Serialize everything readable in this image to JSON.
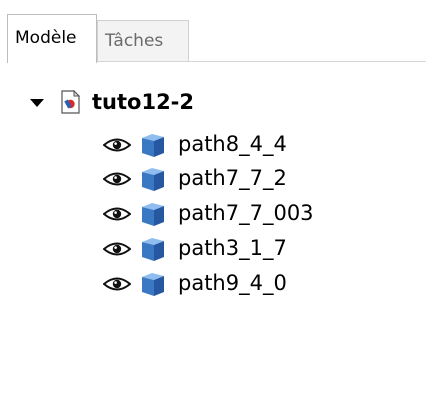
{
  "tabs": [
    {
      "label": "Modèle",
      "active": true
    },
    {
      "label": "Tâches",
      "active": false
    }
  ],
  "tree": {
    "root": {
      "label": "tuto12-2",
      "expanded": true,
      "icon": "document-icon"
    },
    "children": [
      {
        "label": "path8_4_4",
        "visibility_icon": "eye-icon",
        "icon": "cube-icon"
      },
      {
        "label": "path7_7_2",
        "visibility_icon": "eye-icon",
        "icon": "cube-icon"
      },
      {
        "label": "path7_7_003",
        "visibility_icon": "eye-icon",
        "icon": "cube-icon"
      },
      {
        "label": "path3_1_7",
        "visibility_icon": "eye-icon",
        "icon": "cube-icon"
      },
      {
        "label": "path9_4_0",
        "visibility_icon": "eye-icon",
        "icon": "cube-icon"
      }
    ]
  },
  "colors": {
    "cube_front": "#3b78c4",
    "cube_top": "#8fbdf0",
    "cube_side": "#2558a0",
    "tab_border": "#c8c8c8"
  }
}
